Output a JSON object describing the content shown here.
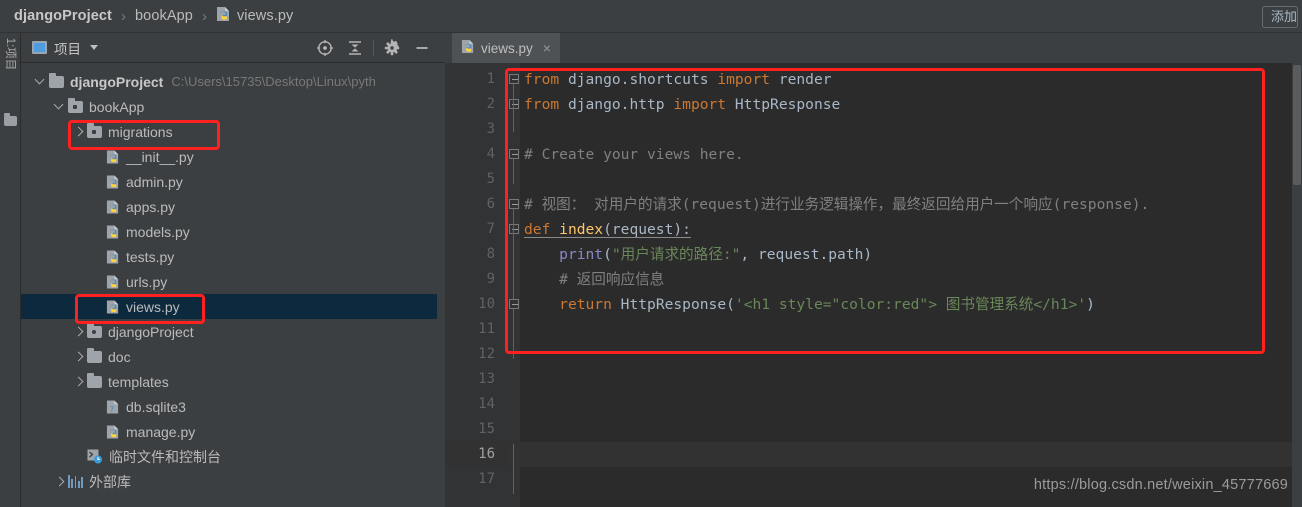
{
  "window": {
    "breadcrumb": [
      {
        "label": "djangoProject",
        "bold": true,
        "icon": null
      },
      {
        "label": "bookApp",
        "bold": false,
        "icon": null
      },
      {
        "label": "views.py",
        "bold": false,
        "icon": "python-file-icon"
      }
    ],
    "separator": "›",
    "add_button_label": "添加"
  },
  "tool_strip": {
    "project_tab_label": "1:项目",
    "favorites_icon": "folder-icon"
  },
  "project_panel": {
    "title": "项目",
    "icons": [
      "locate-target-icon",
      "collapse-all-icon",
      "gear-icon",
      "minimize-icon"
    ],
    "tree": [
      {
        "indent": 0,
        "arrow": "down",
        "icon": "folder-icon",
        "label": "djangoProject",
        "bold": true,
        "path": "C:\\Users\\15735\\Desktop\\Linux\\pyth",
        "selected": false
      },
      {
        "indent": 1,
        "arrow": "down",
        "icon": "module-icon",
        "label": "bookApp",
        "bold": false,
        "path": "",
        "selected": false
      },
      {
        "indent": 2,
        "arrow": "right",
        "icon": "module-icon",
        "label": "migrations",
        "bold": false,
        "path": "",
        "selected": false
      },
      {
        "indent": 3,
        "arrow": "none",
        "icon": "python-file-icon",
        "label": "__init__.py",
        "bold": false,
        "path": "",
        "selected": false
      },
      {
        "indent": 3,
        "arrow": "none",
        "icon": "python-file-icon",
        "label": "admin.py",
        "bold": false,
        "path": "",
        "selected": false
      },
      {
        "indent": 3,
        "arrow": "none",
        "icon": "python-file-icon",
        "label": "apps.py",
        "bold": false,
        "path": "",
        "selected": false
      },
      {
        "indent": 3,
        "arrow": "none",
        "icon": "python-file-icon",
        "label": "models.py",
        "bold": false,
        "path": "",
        "selected": false
      },
      {
        "indent": 3,
        "arrow": "none",
        "icon": "python-file-icon",
        "label": "tests.py",
        "bold": false,
        "path": "",
        "selected": false
      },
      {
        "indent": 3,
        "arrow": "none",
        "icon": "python-file-icon",
        "label": "urls.py",
        "bold": false,
        "path": "",
        "selected": false
      },
      {
        "indent": 3,
        "arrow": "none",
        "icon": "python-file-icon",
        "label": "views.py",
        "bold": false,
        "path": "",
        "selected": true
      },
      {
        "indent": 2,
        "arrow": "right",
        "icon": "source-root-icon",
        "label": "djangoProject",
        "bold": false,
        "path": "",
        "selected": false
      },
      {
        "indent": 2,
        "arrow": "right",
        "icon": "folder-icon",
        "label": "doc",
        "bold": false,
        "path": "",
        "selected": false
      },
      {
        "indent": 2,
        "arrow": "right",
        "icon": "folder-icon",
        "label": "templates",
        "bold": false,
        "path": "",
        "selected": false
      },
      {
        "indent": 3,
        "arrow": "none",
        "icon": "database-file-icon",
        "label": "db.sqlite3",
        "bold": false,
        "path": "",
        "selected": false
      },
      {
        "indent": 3,
        "arrow": "none",
        "icon": "python-file-icon",
        "label": "manage.py",
        "bold": false,
        "path": "",
        "selected": false
      },
      {
        "indent": 2,
        "arrow": "none",
        "icon": "console-icon",
        "label": "临时文件和控制台",
        "bold": false,
        "path": "",
        "selected": false
      },
      {
        "indent": 1,
        "arrow": "right",
        "icon": "library-icon",
        "label": "外部库",
        "bold": false,
        "path": "",
        "selected": false
      }
    ]
  },
  "editor": {
    "tab": {
      "label": "views.py",
      "icon": "python-file-icon",
      "close": "×"
    },
    "current_line": 16,
    "line_numbers": [
      1,
      2,
      3,
      4,
      5,
      6,
      7,
      8,
      9,
      10,
      11,
      12,
      13,
      14,
      15,
      16,
      17
    ],
    "code_lines": [
      {
        "n": 1,
        "tokens": [
          {
            "t": "from ",
            "c": "k"
          },
          {
            "t": "django.shortcuts ",
            "c": "id"
          },
          {
            "t": "import ",
            "c": "k"
          },
          {
            "t": "render",
            "c": "id"
          }
        ]
      },
      {
        "n": 2,
        "tokens": [
          {
            "t": "from ",
            "c": "k"
          },
          {
            "t": "django.http ",
            "c": "id"
          },
          {
            "t": "import ",
            "c": "k"
          },
          {
            "t": "HttpResponse",
            "c": "id"
          }
        ]
      },
      {
        "n": 3,
        "tokens": []
      },
      {
        "n": 4,
        "tokens": [
          {
            "t": "# Create your views here.",
            "c": "cm"
          }
        ]
      },
      {
        "n": 5,
        "tokens": []
      },
      {
        "n": 6,
        "tokens": [
          {
            "t": "# 视图： 对用户的请求(request)进行业务逻辑操作，最终返回给用户一个响应(response).",
            "c": "cm"
          }
        ]
      },
      {
        "n": 7,
        "tokens": [
          {
            "t": "def ",
            "c": "k"
          },
          {
            "t": "index",
            "c": "fn"
          },
          {
            "t": "(request):",
            "c": "id"
          }
        ]
      },
      {
        "n": 8,
        "tokens": [
          {
            "t": "    ",
            "c": "id"
          },
          {
            "t": "print",
            "c": "bi"
          },
          {
            "t": "(",
            "c": "id"
          },
          {
            "t": "\"用户请求的路径:\"",
            "c": "st"
          },
          {
            "t": ", request.path)",
            "c": "id"
          }
        ]
      },
      {
        "n": 9,
        "tokens": [
          {
            "t": "    # 返回响应信息",
            "c": "cm"
          }
        ]
      },
      {
        "n": 10,
        "tokens": [
          {
            "t": "    ",
            "c": "id"
          },
          {
            "t": "return ",
            "c": "k"
          },
          {
            "t": "HttpResponse",
            "c": "id"
          },
          {
            "t": "(",
            "c": "id"
          },
          {
            "t": "'<h1 style=\"color:red\"> 图书管理系统</h1>'",
            "c": "st"
          },
          {
            "t": ")",
            "c": "id"
          }
        ]
      },
      {
        "n": 11,
        "tokens": []
      },
      {
        "n": 12,
        "tokens": []
      },
      {
        "n": 13,
        "tokens": []
      },
      {
        "n": 14,
        "tokens": []
      },
      {
        "n": 15,
        "tokens": []
      },
      {
        "n": 16,
        "tokens": []
      },
      {
        "n": 17,
        "tokens": []
      }
    ]
  },
  "annotations": {
    "boxes": [
      "migrations-highlight",
      "views-py-highlight",
      "code-block-highlight"
    ],
    "color": "#FF2020"
  },
  "watermark": {
    "text": "https://blog.csdn.net/weixin_45777669"
  },
  "colors": {
    "ui_bg": "#3C3F41",
    "editor_bg": "#2B2B2B",
    "gutter_bg": "#313335",
    "selection": "#0D293E",
    "keyword": "#CC7832",
    "identifier": "#A9B7C6",
    "comment": "#808080",
    "string": "#6A8759",
    "function": "#FFC66D",
    "builtin": "#8888C6",
    "annotation_red": "#FF2020"
  }
}
